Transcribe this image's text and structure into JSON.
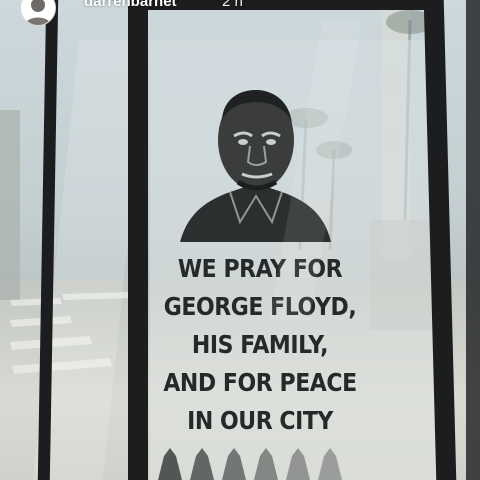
{
  "story_header": {
    "username": "darrenbarnet",
    "timestamp": "2 h"
  },
  "poster": {
    "lines": [
      "WE PRAY FOR",
      "GEORGE FLOYD,",
      "HIS FAMILY,",
      "AND FOR PEACE",
      "IN OUR CITY"
    ],
    "ink_color": "#25292a"
  },
  "icons": {
    "avatar": "user-avatar-icon",
    "praying_hands": "praying-hands-icon"
  },
  "colors": {
    "frame": "#1b1d1e",
    "glass": "#cdd8dc"
  }
}
